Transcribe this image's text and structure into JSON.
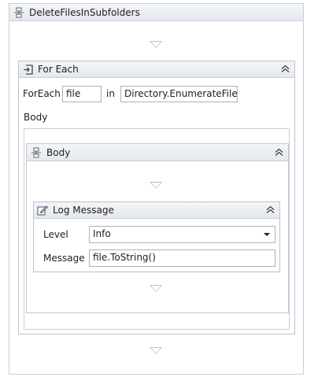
{
  "workflow": {
    "title": "DeleteFilesInSubfolders"
  },
  "foreach": {
    "title": "For Each",
    "foreach_label": "ForEach",
    "item_value": "file",
    "in_label": "in",
    "collection_value": "Directory.EnumerateFiles(r",
    "body_label": "Body"
  },
  "sequence": {
    "title": "Body"
  },
  "logmessage": {
    "title": "Log Message",
    "level_label": "Level",
    "level_value": "Info",
    "message_label": "Message",
    "message_value": "file.ToString()"
  },
  "icons": {
    "workflow": "sequence-icon",
    "foreach": "foreach-icon",
    "sequence": "sequence-icon",
    "log": "log-message-icon",
    "collapse": "collapse-chevron-icon",
    "dropdown": "dropdown-arrow-icon",
    "drop": "drop-target-arrow-icon"
  }
}
